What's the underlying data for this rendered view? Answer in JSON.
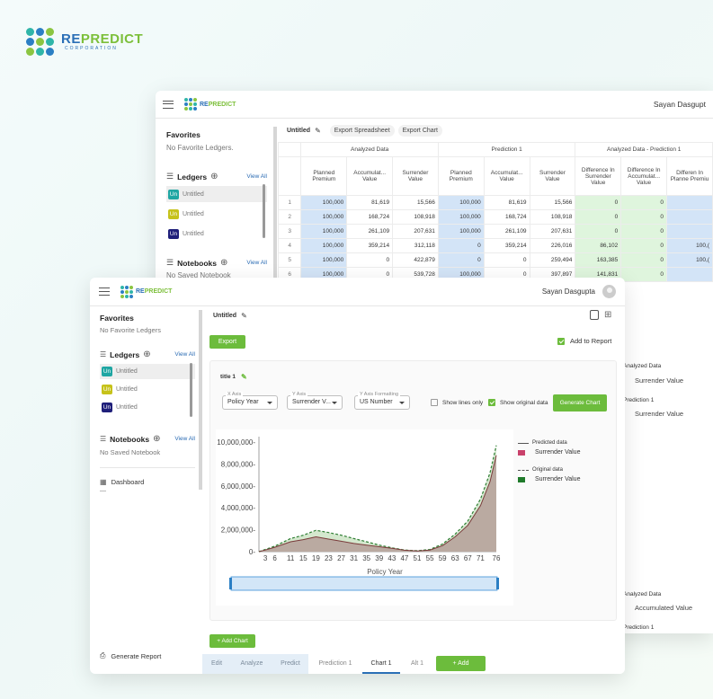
{
  "brand": {
    "prefix": "RE",
    "suffix": "PREDICT",
    "sub": "CORPORATION"
  },
  "back": {
    "user": "Sayan Dasgupt",
    "favorites": "Favorites",
    "no_fav": "No Favorite Ledgers.",
    "ledgers": "Ledgers",
    "view_all": "View All",
    "ledger_items": [
      {
        "chip": "Un",
        "label": "Untitled",
        "color": "#1fa6a3"
      },
      {
        "chip": "Un",
        "label": "Untitled",
        "color": "#c6c21a"
      },
      {
        "chip": "Un",
        "label": "Untitled",
        "color": "#1f1f7a"
      }
    ],
    "notebooks": "Notebooks",
    "no_nb": "No Saved Notebook",
    "toolbar": {
      "title": "Untitled",
      "export_sheet": "Export Spreadsheet",
      "export_chart": "Export Chart"
    },
    "groups": [
      "Analyzed Data",
      "Prediction 1",
      "Analyzed Data - Prediction 1"
    ],
    "cols": [
      "Planned Premium",
      "Accumulat... Value",
      "Surrender Value",
      "Planned Premium",
      "Accumulat... Value",
      "Surrender Value",
      "Difference In Surrender Value",
      "Difference In Accumulat... Value",
      "Differen In Planne Premiu"
    ],
    "rows": [
      [
        "1",
        "100,000",
        "81,619",
        "15,566",
        "100,000",
        "81,619",
        "15,566",
        "0",
        "0",
        ""
      ],
      [
        "2",
        "100,000",
        "168,724",
        "108,918",
        "100,000",
        "168,724",
        "108,918",
        "0",
        "0",
        ""
      ],
      [
        "3",
        "100,000",
        "261,109",
        "207,631",
        "100,000",
        "261,109",
        "207,631",
        "0",
        "0",
        ""
      ],
      [
        "4",
        "100,000",
        "359,214",
        "312,118",
        "0",
        "359,214",
        "226,016",
        "86,102",
        "0",
        "100,("
      ],
      [
        "5",
        "100,000",
        "0",
        "422,879",
        "0",
        "0",
        "259,494",
        "163,385",
        "0",
        "100,("
      ],
      [
        "6",
        "100,000",
        "0",
        "539,728",
        "100,000",
        "0",
        "397,897",
        "141,831",
        "0",
        ""
      ]
    ],
    "right_labels": [
      "Analyzed Data",
      "Surrender Value",
      "Prediction 1",
      "Surrender Value",
      "Analyzed Data",
      "Accumulated Value",
      "Prediction 1"
    ],
    "extra_zero": [
      "0",
      "0"
    ]
  },
  "front": {
    "user": "Sayan Dasgupta",
    "favorites": "Favorites",
    "no_fav": "No Favorite Ledgers",
    "ledgers": "Ledgers",
    "view_all": "View All",
    "ledger_items": [
      {
        "chip": "Un",
        "label": "Untitled",
        "color": "#1fa6a3"
      },
      {
        "chip": "Un",
        "label": "Untitled",
        "color": "#c6c21a"
      },
      {
        "chip": "Un",
        "label": "Untitled",
        "color": "#1f1f7a"
      }
    ],
    "notebooks": "Notebooks",
    "nb_view_all": "View All",
    "no_nb": "No Saved Notebook",
    "dashboard": "Dashboard",
    "dash_sub": "—",
    "generate_report": "Generate Report",
    "doc_title": "Untitled",
    "export": "Export",
    "add_to_report": "Add to Report",
    "chart_title": "title 1",
    "x_axis": {
      "label": "X Axis",
      "value": "Policy Year"
    },
    "y_axis": {
      "label": "Y Axis",
      "value": "Surrender V..."
    },
    "y_fmt": {
      "label": "Y Axis Formatting",
      "value": "US Number"
    },
    "show_lines": "Show lines only",
    "show_original": "Show original data",
    "generate_chart": "Generate Chart",
    "add_chart": "+ Add Chart",
    "tabs": [
      "Edit",
      "Analyze",
      "Predict",
      "Prediction 1",
      "Chart 1",
      "Alt 1"
    ],
    "add_tab": "+ Add",
    "legend": {
      "pred_title": "Predicted data",
      "pred_item": "Surrender Value",
      "pred_color": "#c9416b",
      "orig_title": "Original data",
      "orig_item": "Surrender Value",
      "orig_color": "#1f7a2a"
    }
  },
  "chart_data": {
    "type": "area",
    "xlabel": "Policy Year",
    "x_ticks": [
      "3",
      "6",
      "11",
      "15",
      "19",
      "23",
      "27",
      "31",
      "35",
      "39",
      "43",
      "47",
      "51",
      "55",
      "59",
      "63",
      "67",
      "71",
      "76"
    ],
    "y_ticks": [
      "0",
      "2,000,000",
      "4,000,000",
      "6,000,000",
      "8,000,000",
      "10,000,000"
    ],
    "ylim": [
      0,
      10500000
    ],
    "xlim": [
      1,
      76
    ],
    "series": [
      {
        "name": "Surrender Value",
        "role": "original",
        "x": [
          1,
          3,
          6,
          11,
          15,
          19,
          23,
          27,
          31,
          35,
          39,
          43,
          47,
          51,
          55,
          59,
          63,
          67,
          71,
          74,
          76
        ],
        "values": [
          0,
          200000,
          500000,
          1200000,
          1500000,
          1950000,
          1750000,
          1500000,
          1200000,
          900000,
          600000,
          350000,
          150000,
          80000,
          200000,
          700000,
          1600000,
          2800000,
          4800000,
          7200000,
          9700000
        ]
      },
      {
        "name": "Surrender Value",
        "role": "predicted",
        "x": [
          1,
          3,
          6,
          11,
          15,
          19,
          23,
          27,
          31,
          35,
          39,
          43,
          47,
          51,
          55,
          59,
          63,
          67,
          71,
          74,
          76
        ],
        "values": [
          0,
          150000,
          400000,
          900000,
          1100000,
          1350000,
          1150000,
          950000,
          750000,
          600000,
          450000,
          300000,
          130000,
          60000,
          150000,
          550000,
          1350000,
          2400000,
          4200000,
          6400000,
          8800000
        ]
      }
    ]
  }
}
